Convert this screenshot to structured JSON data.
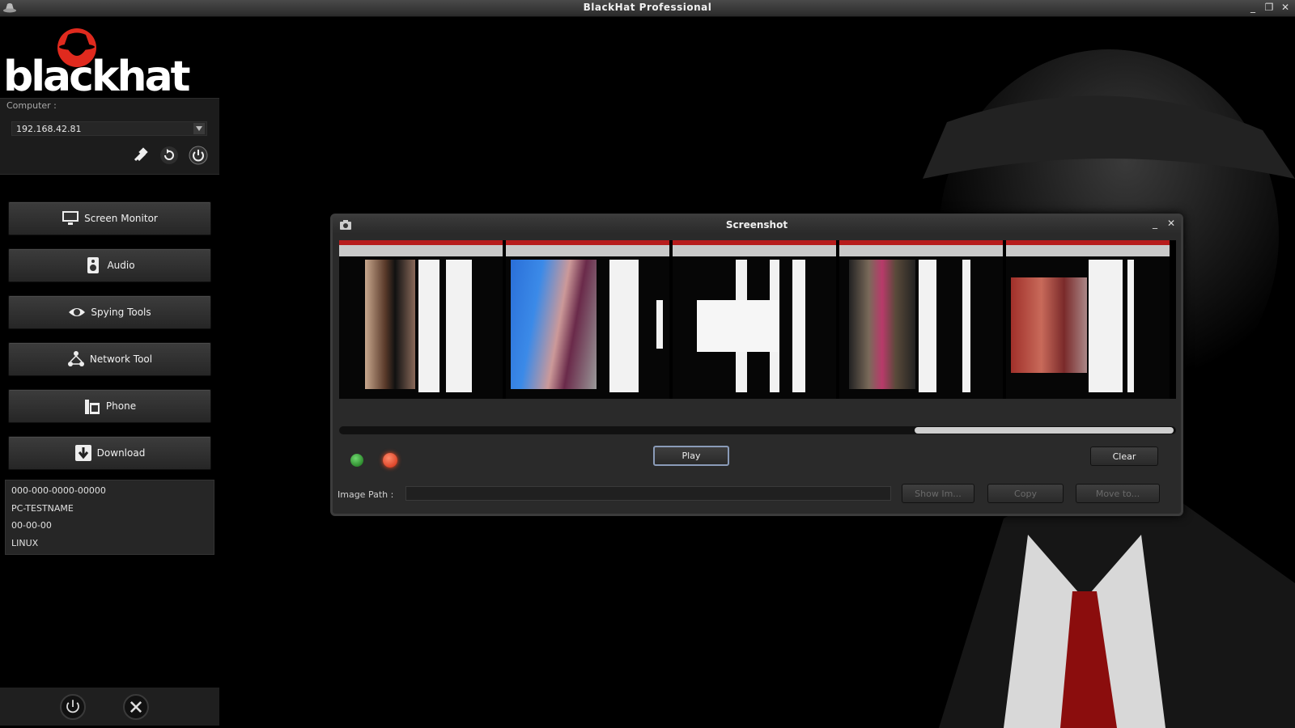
{
  "window": {
    "title": "BlackHat Professional",
    "controls": [
      "minimize",
      "maximize",
      "close"
    ]
  },
  "brand": {
    "wordmark": "blackhat",
    "accent": "#e02a1e"
  },
  "computer": {
    "label": "Computer :",
    "selected_ip": "192.168.42.81"
  },
  "nav": [
    {
      "id": "screen-monitor",
      "label": "Screen Monitor",
      "icon": "monitor-icon"
    },
    {
      "id": "audio",
      "label": "Audio",
      "icon": "speaker-icon"
    },
    {
      "id": "spying-tools",
      "label": "Spying Tools",
      "icon": "eye-icon"
    },
    {
      "id": "network-tool",
      "label": "Network Tool",
      "icon": "network-icon"
    },
    {
      "id": "phone",
      "label": "Phone",
      "icon": "phone-icon"
    },
    {
      "id": "download",
      "label": "Download",
      "icon": "download-icon"
    }
  ],
  "info": [
    "000-000-0000-00000",
    "PC-TESTNAME",
    "00-00-00",
    "LINUX"
  ],
  "screenshot_dialog": {
    "title": "Screenshot",
    "play_label": "Play",
    "clear_label": "Clear",
    "image_path_label": "Image Path :",
    "image_path_value": "",
    "show_label": "Show Im...",
    "copy_label": "Copy",
    "move_label": "Move to...",
    "thumbnails": 5
  }
}
